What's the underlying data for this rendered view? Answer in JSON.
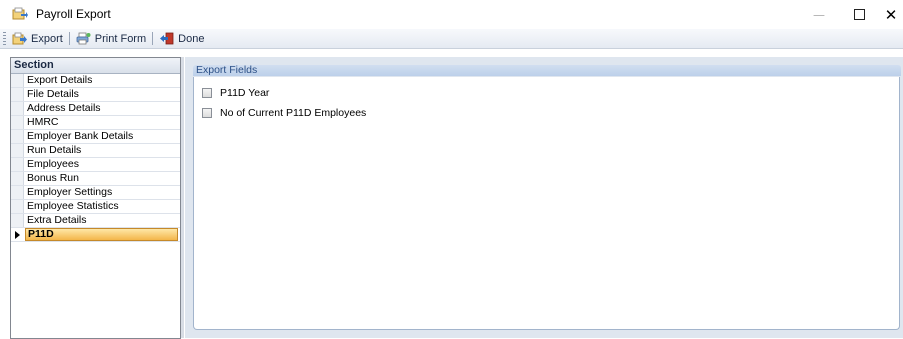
{
  "window": {
    "title": "Payroll Export",
    "minimize_glyph": "—",
    "close_glyph": "✕"
  },
  "toolbar": {
    "export_label": "Export",
    "print_label": "Print Form",
    "done_label": "Done"
  },
  "sections": {
    "header": "Section",
    "items": [
      {
        "label": "Export Details"
      },
      {
        "label": "File Details"
      },
      {
        "label": "Address Details"
      },
      {
        "label": "HMRC"
      },
      {
        "label": "Employer Bank Details"
      },
      {
        "label": "Run Details"
      },
      {
        "label": "Employees"
      },
      {
        "label": "Bonus Run"
      },
      {
        "label": "Employer Settings"
      },
      {
        "label": "Employee Statistics"
      },
      {
        "label": "Extra Details"
      },
      {
        "label": "P11D"
      }
    ],
    "selected": "P11D"
  },
  "export_fields": {
    "title": "Export Fields",
    "fields": [
      {
        "label": "P11D Year",
        "checked": false
      },
      {
        "label": "No of Current P11D Employees",
        "checked": false
      }
    ]
  },
  "colors": {
    "selection": "#f4b64a",
    "group_header": "#bcd0ea"
  }
}
